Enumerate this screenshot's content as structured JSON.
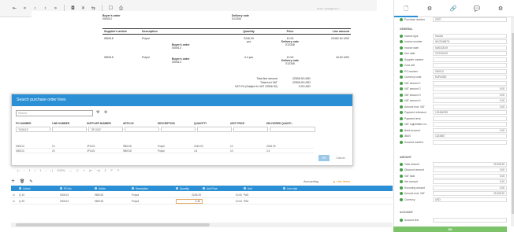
{
  "toolbar": {
    "buttons": [
      "⇤",
      "«",
      "‹",
      "›",
      "»",
      "◘",
      "✕",
      "⇆",
      "☐",
      "⎙"
    ],
    "meta_text": "Ihr Nr. / Auftrags-Nr. / ..."
  },
  "document": {
    "buyers_order_label": "Buyer's order",
    "buyers_order_value": "000013",
    "delivery_note_label": "Delivery note",
    "delivery_note_value": "012345",
    "columns": [
      "Supplier's article",
      "Description",
      "",
      "Quantity",
      "Price",
      "Line amount"
    ],
    "rows": [
      {
        "article": "980018",
        "desc": "Pulpol",
        "sub": "",
        "sub2": "",
        "qty": "2246.29",
        "qty_unit": "pcs",
        "price": "10.00",
        "price_sub": "Delivery note",
        "price_sub2": "012345",
        "amount": "22462.90 USD"
      },
      {
        "article": "980018",
        "desc": "Pulpol",
        "sub": "Buyer's order",
        "sub2": "000013",
        "qty": "4.4",
        "qty_unit": "pcs",
        "price": "10.00",
        "price_sub": "Delivery note",
        "price_sub2": "012345",
        "amount": "44.00 USD"
      }
    ],
    "row1_sub": "Buyer's order",
    "row1_sub2": "000013",
    "totals": [
      {
        "label": "Total line amount",
        "value": "22506.90 USD"
      },
      {
        "label": "Total excl VAT",
        "value": "22506.90 USD"
      },
      {
        "label": "VAT 0% (Subject to VAT 22506.90)",
        "value": "0.00 USD"
      }
    ]
  },
  "modal": {
    "title": "Search purchase order lines",
    "search_placeholder": "Search",
    "columns": [
      "PO NUMBER",
      "LINE NUMBER",
      "SUPPLIER NUMBER",
      "ARTICLE",
      "DESCRIPTION",
      "QUANTITY",
      "UNIT PRICE",
      "DELIVERED QUANTI..."
    ],
    "filters": [
      "\"000013\"",
      "",
      "\"3F1015\"",
      "",
      "",
      "",
      "",
      ""
    ],
    "rows": [
      [
        "000013",
        "10",
        "JP1101",
        "980018",
        "Pulpol",
        "2246.29",
        "10",
        "2246.29"
      ],
      [
        "000013",
        "20",
        "JP1101",
        "980018",
        "Pulpol",
        "4.4",
        "10",
        "4.4"
      ]
    ],
    "ok_label": "OK",
    "cancel_label": "Cancel"
  },
  "pager": {
    "items": [
      "|‹",
      "‹",
      "1",
      "/",
      "1",
      "›",
      "›|",
      "100%",
      "—",
      "○",
      "+",
      "|⇤",
      "⇥|",
      "↕",
      "↶",
      "↷"
    ]
  },
  "grid": {
    "tools": [
      "+",
      "🗑",
      "✎"
    ],
    "accounting_label": "Accounting",
    "line_items_label": "Line items",
    "columns": [
      "",
      "Linked",
      "PO No.",
      "Article",
      "Description",
      "Quantity",
      "Unit Price",
      "Unit",
      "Line total"
    ],
    "rows": [
      [
        "⊙",
        "Q 10",
        "000013",
        "980018",
        "Pulpol",
        "2246.29",
        "10.00",
        "PAS",
        ""
      ],
      [
        "⊙",
        "Q 20",
        "000013",
        "980018",
        "Pulpol",
        "4.40",
        "10.00",
        "PAS",
        ""
      ]
    ]
  },
  "panel": {
    "tabs": [
      "🗋",
      "⚙",
      "🔗",
      "💬",
      "⚙"
    ],
    "top_fields": [
      {
        "label": "Purchase number",
        "value": "ZPZ7"
      }
    ],
    "general_title": "GENERAL",
    "general_fields": [
      {
        "label": "Invoice type",
        "value": "Invoice"
      },
      {
        "label": "Invoice number",
        "value": "INV2345678"
      },
      {
        "label": "Invoice date",
        "value": "04/03/2019"
      },
      {
        "label": "Due date",
        "value": "07/29/2019"
      },
      {
        "label": "Supplier number",
        "value": ""
      },
      {
        "label": "Cost unit",
        "value": ""
      },
      {
        "label": "PO number",
        "value": "000013"
      },
      {
        "label": "Currency code",
        "value": "EUR/USD"
      },
      {
        "label": "VAT amount 1",
        "value": ""
      },
      {
        "label": "VAT amount 2",
        "value": "0.00"
      },
      {
        "label": "VAT amount 3",
        "value": "0.00"
      },
      {
        "label": "VAT amount 4",
        "value": "0.00"
      },
      {
        "label": "Amount excl. VAT",
        "value": "0.00"
      },
      {
        "label": "Payment reference",
        "value": "123456789"
      },
      {
        "label": "Payment term",
        "value": ""
      },
      {
        "label": "VAT registration no.",
        "value": ""
      },
      {
        "label": "Bank account",
        "value": "0.00"
      },
      {
        "label": "IBAN",
        "value": "1234567"
      },
      {
        "label": "Account number",
        "value": ""
      }
    ],
    "amount_title": "AMOUNT",
    "amount_fields": [
      {
        "label": "Total amount",
        "value": "22,506.90"
      },
      {
        "label": "Discount amount",
        "value": "0.00"
      },
      {
        "label": "VAT total",
        "value": "0.00"
      },
      {
        "label": "Net amount",
        "value": "0.00"
      },
      {
        "label": "Rounding amount",
        "value": "0.00"
      },
      {
        "label": "Amount excl. VAT",
        "value": "22,506.90"
      },
      {
        "label": "Currency",
        "value": "USD"
      }
    ],
    "account_title": "ACCOUNT",
    "account_fields": [
      {
        "label": "Account text",
        "value": ""
      }
    ],
    "ok_label": "OK"
  },
  "colors": {
    "accent": "#2a8fd4",
    "status": "#43a047",
    "ok": "#7cc36a",
    "highlight": "#e7a65d"
  }
}
